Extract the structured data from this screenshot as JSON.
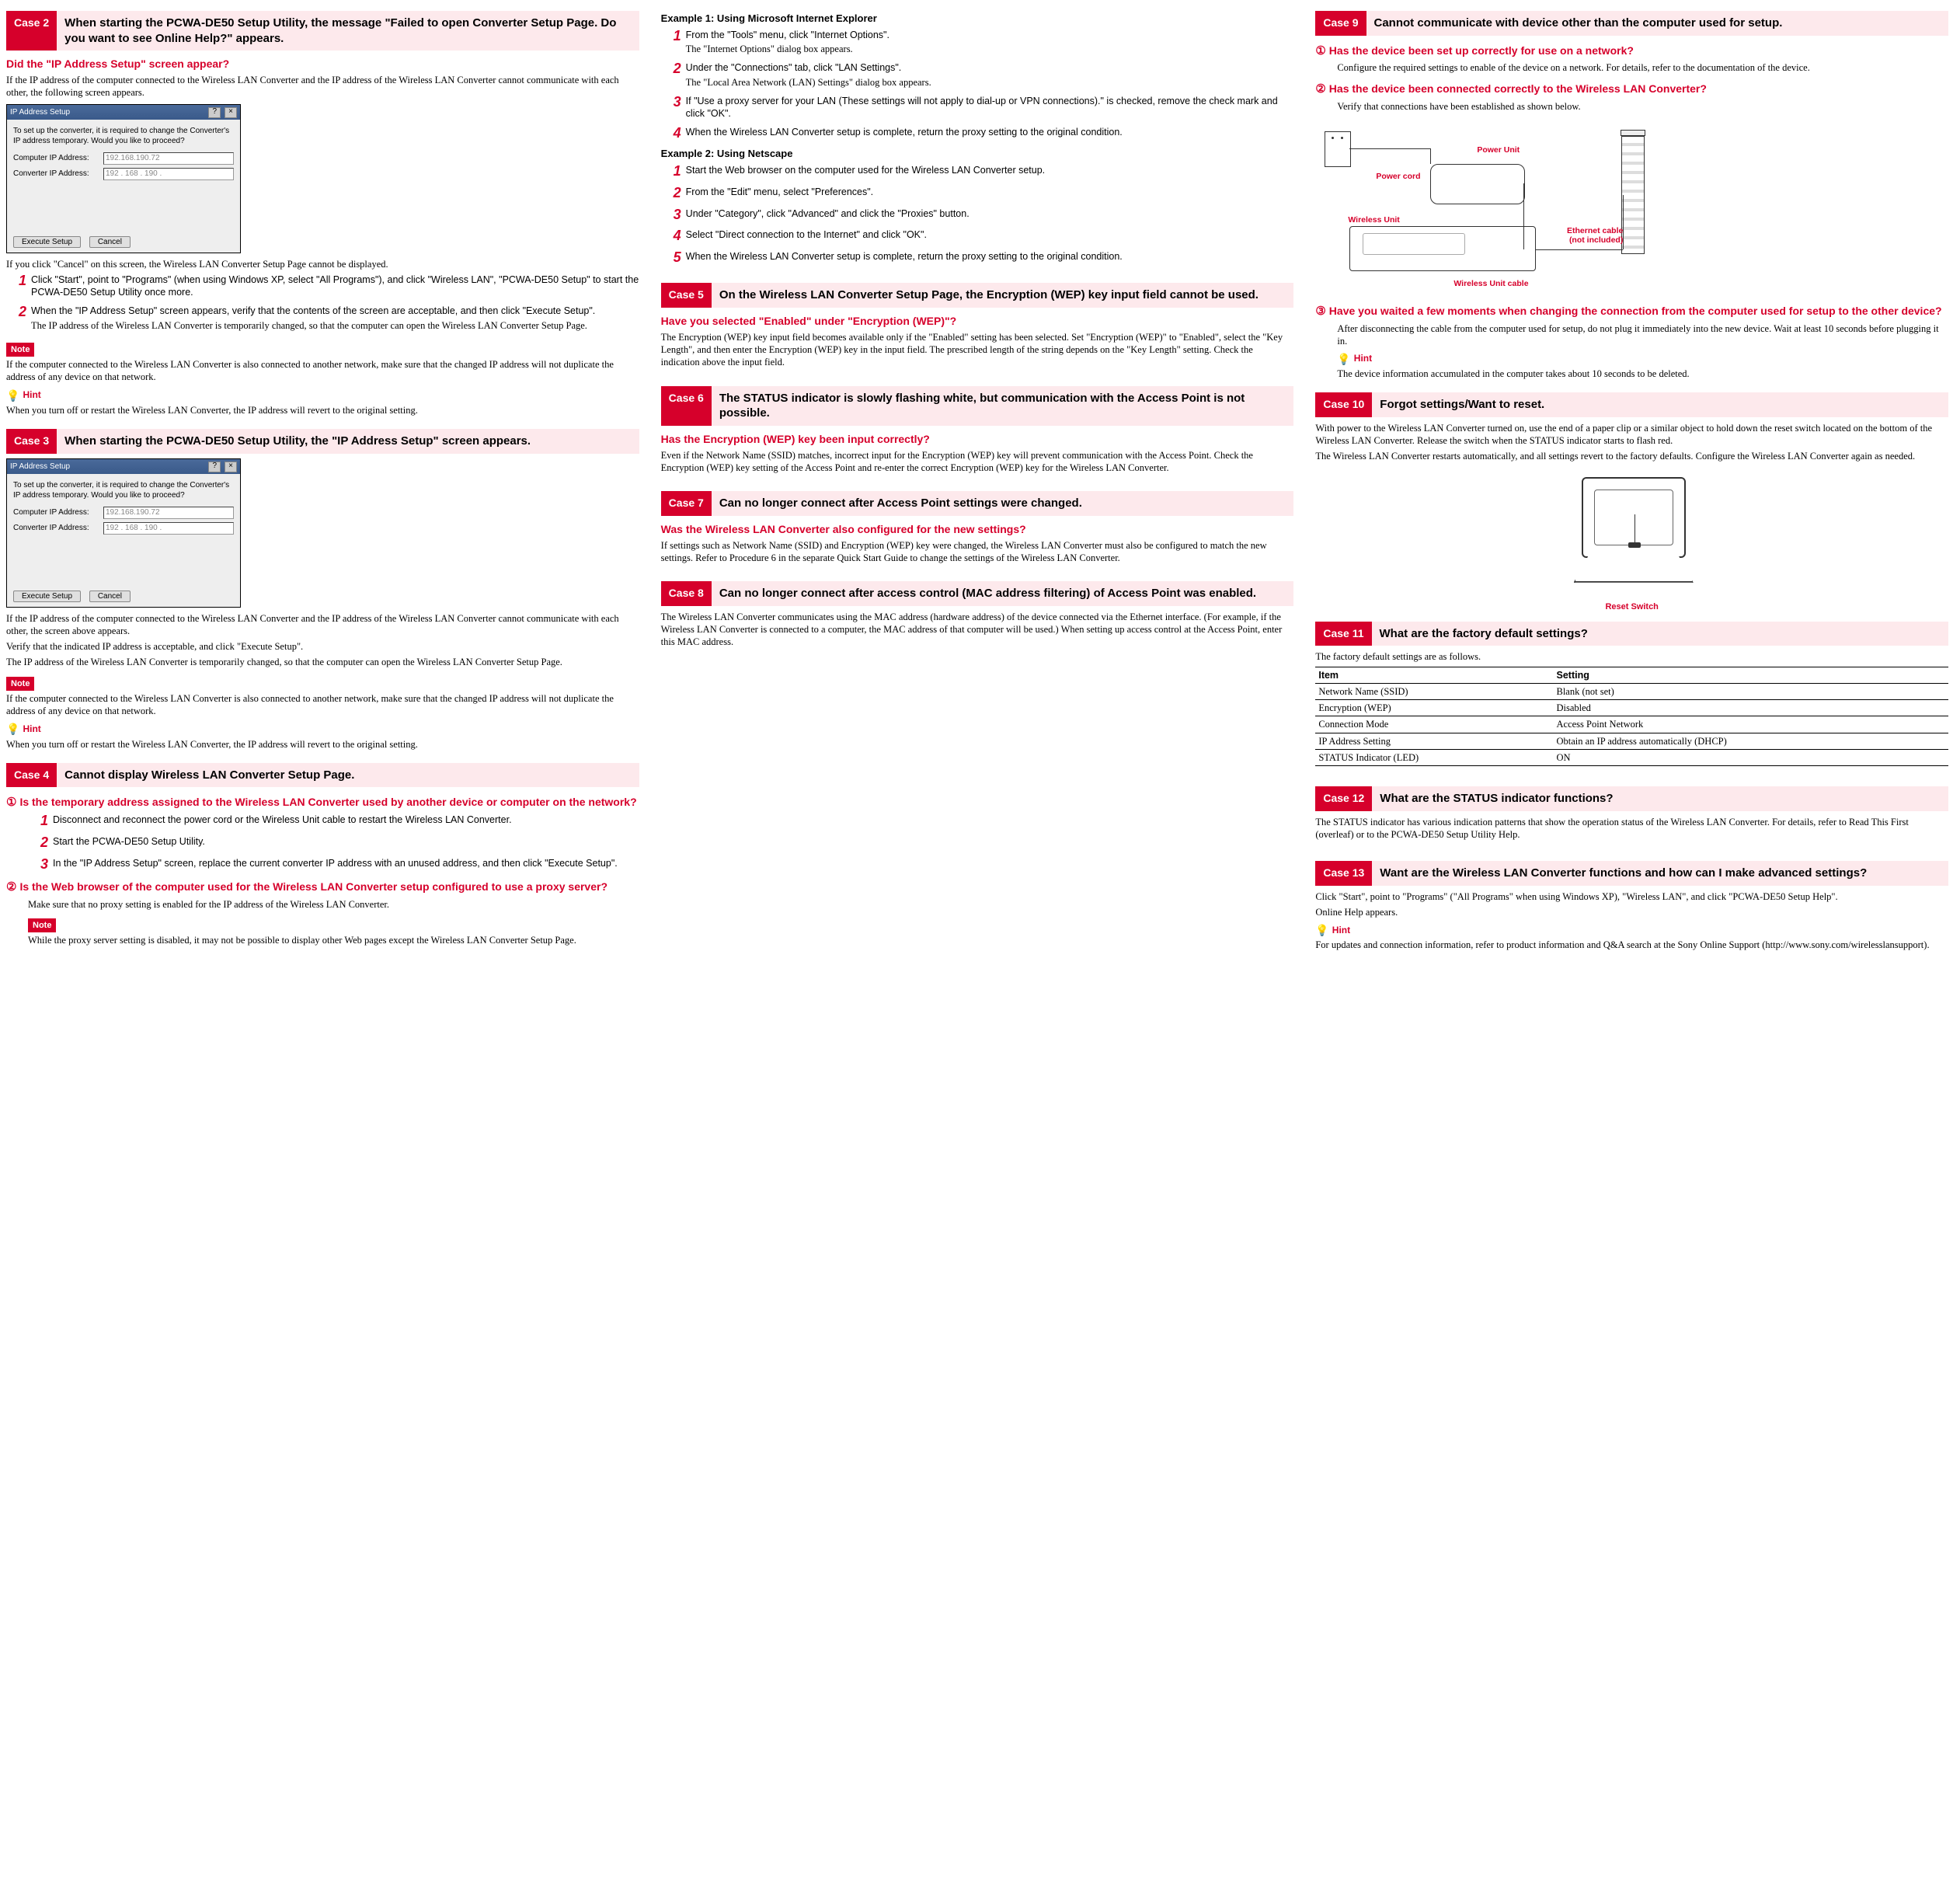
{
  "labels": {
    "note": "Note",
    "hint": "Hint"
  },
  "dialog": {
    "title": "IP Address Setup",
    "help_btn": "?",
    "close_btn": "×",
    "intro": "To set up the converter, it is required to change the Converter's IP address temporary. Would you like to proceed?",
    "row1_label": "Computer IP Address:",
    "row1_value": "192.168.190.72",
    "row2_label": "Converter IP Address:",
    "row2_value": "192 . 168 . 190 .",
    "btn_exec": "Execute Setup",
    "btn_cancel": "Cancel"
  },
  "case2": {
    "tag": "Case 2",
    "title": "When starting the PCWA-DE50 Setup Utility, the message \"Failed to open Converter Setup Page. Do you want to see Online Help?\" appears.",
    "q1": "Did the \"IP Address Setup\" screen appear?",
    "p1": "If the IP address of the computer connected to the Wireless LAN Converter and the IP address of the Wireless LAN Converter cannot communicate with each other, the following screen appears.",
    "p2": "If you click \"Cancel\" on this screen, the Wireless LAN Converter Setup Page cannot be displayed.",
    "step1": "Click \"Start\", point to \"Programs\" (when using Windows XP, select \"All Programs\"), and click \"Wireless LAN\", \"PCWA-DE50 Setup\" to start the PCWA-DE50 Setup Utility once more.",
    "step2a": "When the \"IP Address Setup\" screen appears, verify that the contents of the screen are acceptable, and then click \"Execute Setup\".",
    "step2b": "The IP address of the Wireless LAN Converter is temporarily changed, so that the computer can open the Wireless LAN Converter Setup Page.",
    "note": "If the computer connected to the Wireless LAN Converter is also connected to another network, make sure that the changed IP address will not duplicate the address of any device on that network.",
    "hint": "When you turn off or restart the Wireless LAN Converter, the IP address will revert to the original setting."
  },
  "case3": {
    "tag": "Case 3",
    "title": "When starting the PCWA-DE50 Setup Utility, the \"IP Address Setup\" screen appears.",
    "p1": "If the IP address of the computer connected to the Wireless LAN Converter and the IP address of the Wireless LAN Converter cannot communicate with each other, the screen above appears.",
    "p2": "Verify that the indicated IP address is acceptable, and click \"Execute Setup\".",
    "p3": "The IP address of the Wireless LAN Converter is temporarily changed, so that the computer can open the Wireless LAN Converter Setup Page.",
    "note": "If the computer connected to the Wireless LAN Converter is also connected to another network, make sure that the changed IP address will not duplicate the address of any device on that network.",
    "hint": "When you turn off or restart the Wireless LAN Converter, the IP address will revert to the original setting."
  },
  "case4": {
    "tag": "Case 4",
    "title": "Cannot display Wireless LAN Converter Setup Page.",
    "q1": "Is the temporary address assigned to the Wireless LAN Converter used by another device or computer on the network?",
    "s1": "Disconnect and reconnect the power cord or the Wireless Unit cable to restart the Wireless LAN Converter.",
    "s2": "Start the PCWA-DE50 Setup Utility.",
    "s3": "In the \"IP Address Setup\" screen, replace the current converter IP address with an unused address, and then click \"Execute Setup\".",
    "q2": "Is the Web browser of the computer used for the Wireless LAN Converter setup configured to use a proxy server?",
    "p1": "Make sure that no proxy setting is enabled for the IP address of the Wireless LAN Converter.",
    "note": "While the proxy server setting is disabled, it may not be possible to display other Web pages except the Wireless LAN Converter Setup Page."
  },
  "examples": {
    "h1": "Example 1: Using Microsoft Internet Explorer",
    "e1s1a": "From the \"Tools\" menu, click \"Internet Options\".",
    "e1s1b": "The \"Internet Options\" dialog box appears.",
    "e1s2a": "Under the \"Connections\" tab, click \"LAN Settings\".",
    "e1s2b": "The \"Local Area Network (LAN) Settings\" dialog box appears.",
    "e1s3": "If \"Use a proxy server for your LAN (These settings will not apply to dial-up or VPN connections).\" is checked, remove the check mark and click \"OK\".",
    "e1s4": "When the Wireless LAN Converter setup is complete, return the proxy setting to the original condition.",
    "h2": "Example 2: Using Netscape",
    "e2s1": "Start the Web browser on the computer used for the Wireless LAN Converter setup.",
    "e2s2": "From the \"Edit\" menu, select \"Preferences\".",
    "e2s3": "Under \"Category\", click \"Advanced\" and click the \"Proxies\" button.",
    "e2s4": "Select \"Direct connection to the Internet\" and click \"OK\".",
    "e2s5": "When the Wireless LAN Converter setup is complete, return the proxy setting to the original condition."
  },
  "case5": {
    "tag": "Case 5",
    "title": "On the Wireless LAN Converter Setup Page, the Encryption (WEP) key input field cannot be used.",
    "q": "Have you selected \"Enabled\" under \"Encryption (WEP)\"?",
    "p": "The Encryption (WEP) key input field becomes available only if the \"Enabled\" setting has been selected. Set \"Encryption (WEP)\" to \"Enabled\", select the \"Key Length\", and then enter the Encryption (WEP) key in the input field. The prescribed length of the string depends on the \"Key Length\" setting. Check the indication above the input field."
  },
  "case6": {
    "tag": "Case 6",
    "title": "The STATUS indicator is slowly flashing white, but communication with the Access Point is not possible.",
    "q": "Has the Encryption (WEP) key been input correctly?",
    "p": "Even if the Network Name (SSID) matches, incorrect input for the Encryption (WEP) key will prevent communication with the Access Point. Check the Encryption (WEP) key setting of the Access Point and re-enter the correct Encryption (WEP) key for the Wireless LAN Converter."
  },
  "case7": {
    "tag": "Case 7",
    "title": "Can no longer connect after Access Point settings were changed.",
    "q": "Was the Wireless LAN Converter also configured for the new settings?",
    "p": "If settings such as Network Name (SSID) and Encryption (WEP) key were changed, the Wireless LAN Converter must also be configured to match the new settings. Refer to Procedure 6 in the separate Quick Start Guide to change the settings of the Wireless LAN Converter."
  },
  "case8": {
    "tag": "Case 8",
    "title": "Can no longer connect after access control (MAC address filtering) of Access Point was enabled.",
    "p": "The Wireless LAN Converter communicates using the MAC address (hardware address) of the device connected via the Ethernet interface. (For example, if the Wireless LAN Converter is connected to a computer, the MAC address of that computer will be used.) When setting up access control at the Access Point, enter this MAC address."
  },
  "case9": {
    "tag": "Case 9",
    "title": "Cannot communicate with device other than the computer used for setup.",
    "q1": "Has the device been set up correctly for use on a network?",
    "p1": "Configure the required settings to enable of the device on a network. For details, refer to the documentation of the device.",
    "q2": "Has the device been connected correctly to the Wireless LAN Converter?",
    "p2": "Verify that connections have been established as shown below.",
    "wlabels": {
      "powerunit": "Power Unit",
      "powercord": "Power cord",
      "wirelessunit": "Wireless Unit",
      "wirelesscable": "Wireless Unit cable",
      "ethernet1": "Ethernet cable",
      "ethernet2": "(not included)"
    },
    "q3": "Have you waited a few moments when changing the connection from the computer used for setup to the other device?",
    "p3": "After disconnecting the cable from the computer used for setup, do not plug it immediately into the new device. Wait at least 10 seconds before plugging it in.",
    "hint": "The device information accumulated in the computer takes about 10 seconds to be deleted."
  },
  "case10": {
    "tag": "Case 10",
    "title": "Forgot settings/Want to reset.",
    "p1": "With power to the Wireless LAN Converter turned on, use the end of a paper clip or a similar object to hold down the reset switch located on the bottom of the Wireless LAN Converter. Release the switch when the STATUS indicator starts to flash red.",
    "p2": "The Wireless LAN Converter restarts automatically, and all settings revert to the factory defaults. Configure the Wireless LAN Converter again as needed.",
    "resetlabel": "Reset Switch"
  },
  "case11": {
    "tag": "Case 11",
    "title": "What are the factory default settings?",
    "intro": "The factory default settings are as follows.",
    "th1": "Item",
    "th2": "Setting",
    "rows": [
      {
        "item": "Network Name (SSID)",
        "setting": "Blank (not set)"
      },
      {
        "item": "Encryption (WEP)",
        "setting": "Disabled"
      },
      {
        "item": "Connection Mode",
        "setting": "Access Point Network"
      },
      {
        "item": "IP Address Setting",
        "setting": "Obtain an IP address automatically (DHCP)"
      },
      {
        "item": "STATUS Indicator (LED)",
        "setting": "ON"
      }
    ]
  },
  "case12": {
    "tag": "Case 12",
    "title": "What are the STATUS indicator functions?",
    "p": "The STATUS indicator has various indication patterns that show the operation status of the Wireless LAN Converter. For details, refer to Read This First (overleaf) or to the PCWA-DE50 Setup Utility Help."
  },
  "case13": {
    "tag": "Case 13",
    "title": "Want are the Wireless LAN Converter functions and how can I make advanced settings?",
    "p1": "Click \"Start\", point to \"Programs\" (\"All Programs\" when using Windows XP), \"Wireless LAN\", and click \"PCWA-DE50 Setup Help\".",
    "p2": "Online Help appears.",
    "hint": "For updates and connection information, refer to product information and Q&A search at the Sony Online Support (http://www.sony.com/wirelesslansupport)."
  }
}
